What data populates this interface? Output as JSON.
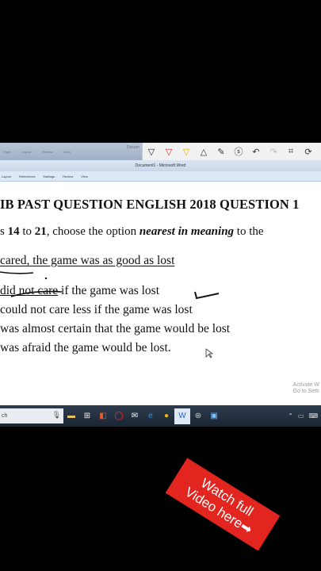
{
  "window": {
    "app_label": "Docum",
    "title": "Document1 - Microsoft Word",
    "ribbon_tabs": [
      "Page",
      "Layout",
      "Review",
      "View"
    ],
    "menu_tabs": [
      "Layout",
      "References",
      "Mailings",
      "Review",
      "View"
    ]
  },
  "pen_toolbar": {
    "tools": [
      {
        "name": "pen-black-icon",
        "glyph": "▽"
      },
      {
        "name": "pen-red-icon",
        "glyph": "▽"
      },
      {
        "name": "pen-yellow-icon",
        "glyph": "▽"
      },
      {
        "name": "eraser-icon",
        "glyph": "△"
      },
      {
        "name": "highlighter-icon",
        "glyph": "✎"
      },
      {
        "name": "lasso-icon",
        "glyph": "ⓢ"
      },
      {
        "name": "undo-icon",
        "glyph": "↶"
      },
      {
        "name": "redo-icon",
        "glyph": "↷"
      },
      {
        "name": "crop-icon",
        "glyph": "⌗"
      },
      {
        "name": "screenshot-icon",
        "glyph": "⟳"
      }
    ]
  },
  "document": {
    "heading": "IB PAST QUESTION ENGLISH 2018 QUESTION 1",
    "instruction_pre": "s ",
    "instruction_num1": "14",
    "instruction_mid": " to ",
    "instruction_num2": "21",
    "instruction_post": ", choose the option ",
    "instruction_emph": "nearest in meaning",
    "instruction_end": " to the",
    "question": "cared, the game was as good as lost",
    "option_a_underlined": "did not care",
    "option_a_rest": " if the game was lost",
    "option_b": "could not care less if the game was lost",
    "option_c": "was almost certain that the game would be lost",
    "option_d": "was afraid the game would be lost."
  },
  "watermark": {
    "line1": "Activate W",
    "line2": "Go to Setti"
  },
  "taskbar": {
    "search_text": "ch",
    "icons": [
      {
        "name": "file-explorer-icon",
        "glyph": "▬",
        "color": "#e8c45a"
      },
      {
        "name": "store-icon",
        "glyph": "⊞",
        "color": "#f2f2f2"
      },
      {
        "name": "office-icon",
        "glyph": "◧",
        "color": "#f05a28"
      },
      {
        "name": "opera-icon",
        "glyph": "◯",
        "color": "#ff2b2b"
      },
      {
        "name": "mail-icon",
        "glyph": "✉",
        "color": "#ffffff"
      },
      {
        "name": "edge-icon",
        "glyph": "e",
        "color": "#3a8fe6"
      },
      {
        "name": "chrome-icon",
        "glyph": "●",
        "color": "#f4b400"
      },
      {
        "name": "word-icon",
        "glyph": "W",
        "color": "#2b66c9"
      },
      {
        "name": "settings-icon",
        "glyph": "⊛",
        "color": "#cccccc"
      },
      {
        "name": "photos-icon",
        "glyph": "▣",
        "color": "#7cc4ff"
      }
    ],
    "tray": [
      "⌃",
      "▭",
      "⌨"
    ]
  },
  "promo": {
    "line1": "Watch full",
    "line2": "Video here➡"
  }
}
